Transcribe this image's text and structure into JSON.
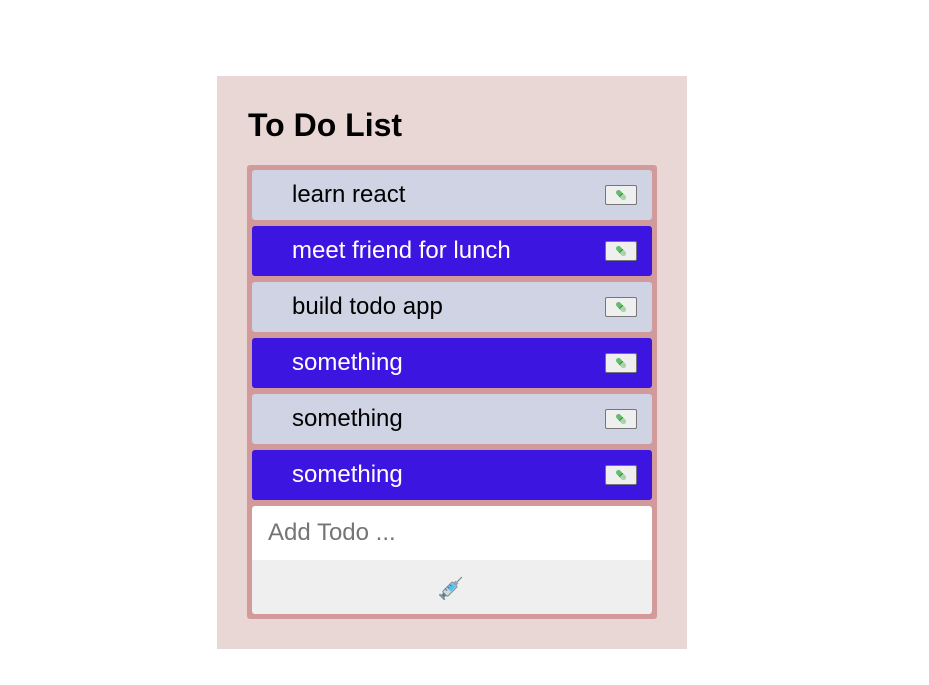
{
  "header": {
    "title": "To Do List"
  },
  "todos": [
    {
      "text": "learn react",
      "style": "light",
      "delete_icon": "pill-icon"
    },
    {
      "text": "meet friend for lunch",
      "style": "dark",
      "delete_icon": "pill-icon"
    },
    {
      "text": "build todo app",
      "style": "light",
      "delete_icon": "pill-icon"
    },
    {
      "text": "something",
      "style": "dark",
      "delete_icon": "pill-icon"
    },
    {
      "text": "something",
      "style": "light",
      "delete_icon": "pill-icon"
    },
    {
      "text": "something",
      "style": "dark",
      "delete_icon": "pill-icon"
    }
  ],
  "add_form": {
    "input_value": "",
    "placeholder": "Add Todo ...",
    "submit_icon": "syringe-icon"
  },
  "colors": {
    "app_background": "#e8d7d4",
    "list_border": "#d29a9a",
    "item_light": "#cfd3e3",
    "item_dark": "#3c16e0",
    "button_background": "#efefef"
  }
}
